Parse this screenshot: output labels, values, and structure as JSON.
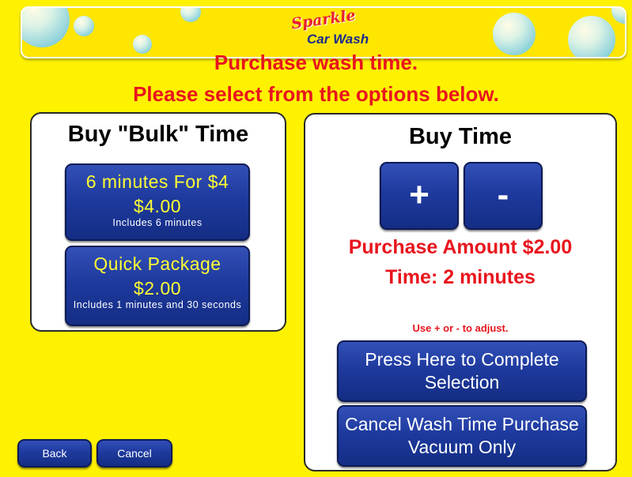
{
  "brand": {
    "logo_top": "Sparkle",
    "logo_bottom": "Car Wash"
  },
  "headline": {
    "line1": "Purchase wash time.",
    "line2": "Please select from the options below."
  },
  "bulk": {
    "title": "Buy \"Bulk\" Time",
    "packages": [
      {
        "name": "6 minutes For $4",
        "price": "$4.00",
        "desc": "Includes 6 minutes"
      },
      {
        "name": "Quick Package",
        "price": "$2.00",
        "desc": "Includes 1 minutes and 30 seconds"
      }
    ]
  },
  "buy_time": {
    "title": "Buy Time",
    "plus_label": "+",
    "minus_label": "-",
    "purchase_amount": "Purchase Amount $2.00",
    "time": "Time: 2 minutes",
    "hint": "Use + or - to adjust.",
    "complete_label": "Press Here to Complete Selection",
    "cancel_wash_label": "Cancel Wash Time Purchase Vacuum Only"
  },
  "footer": {
    "back_label": "Back",
    "cancel_label": "Cancel"
  },
  "colors": {
    "background": "#fff200",
    "headline": "#e8151d",
    "button": "#1e3a9e",
    "price_text": "#ffff33"
  }
}
